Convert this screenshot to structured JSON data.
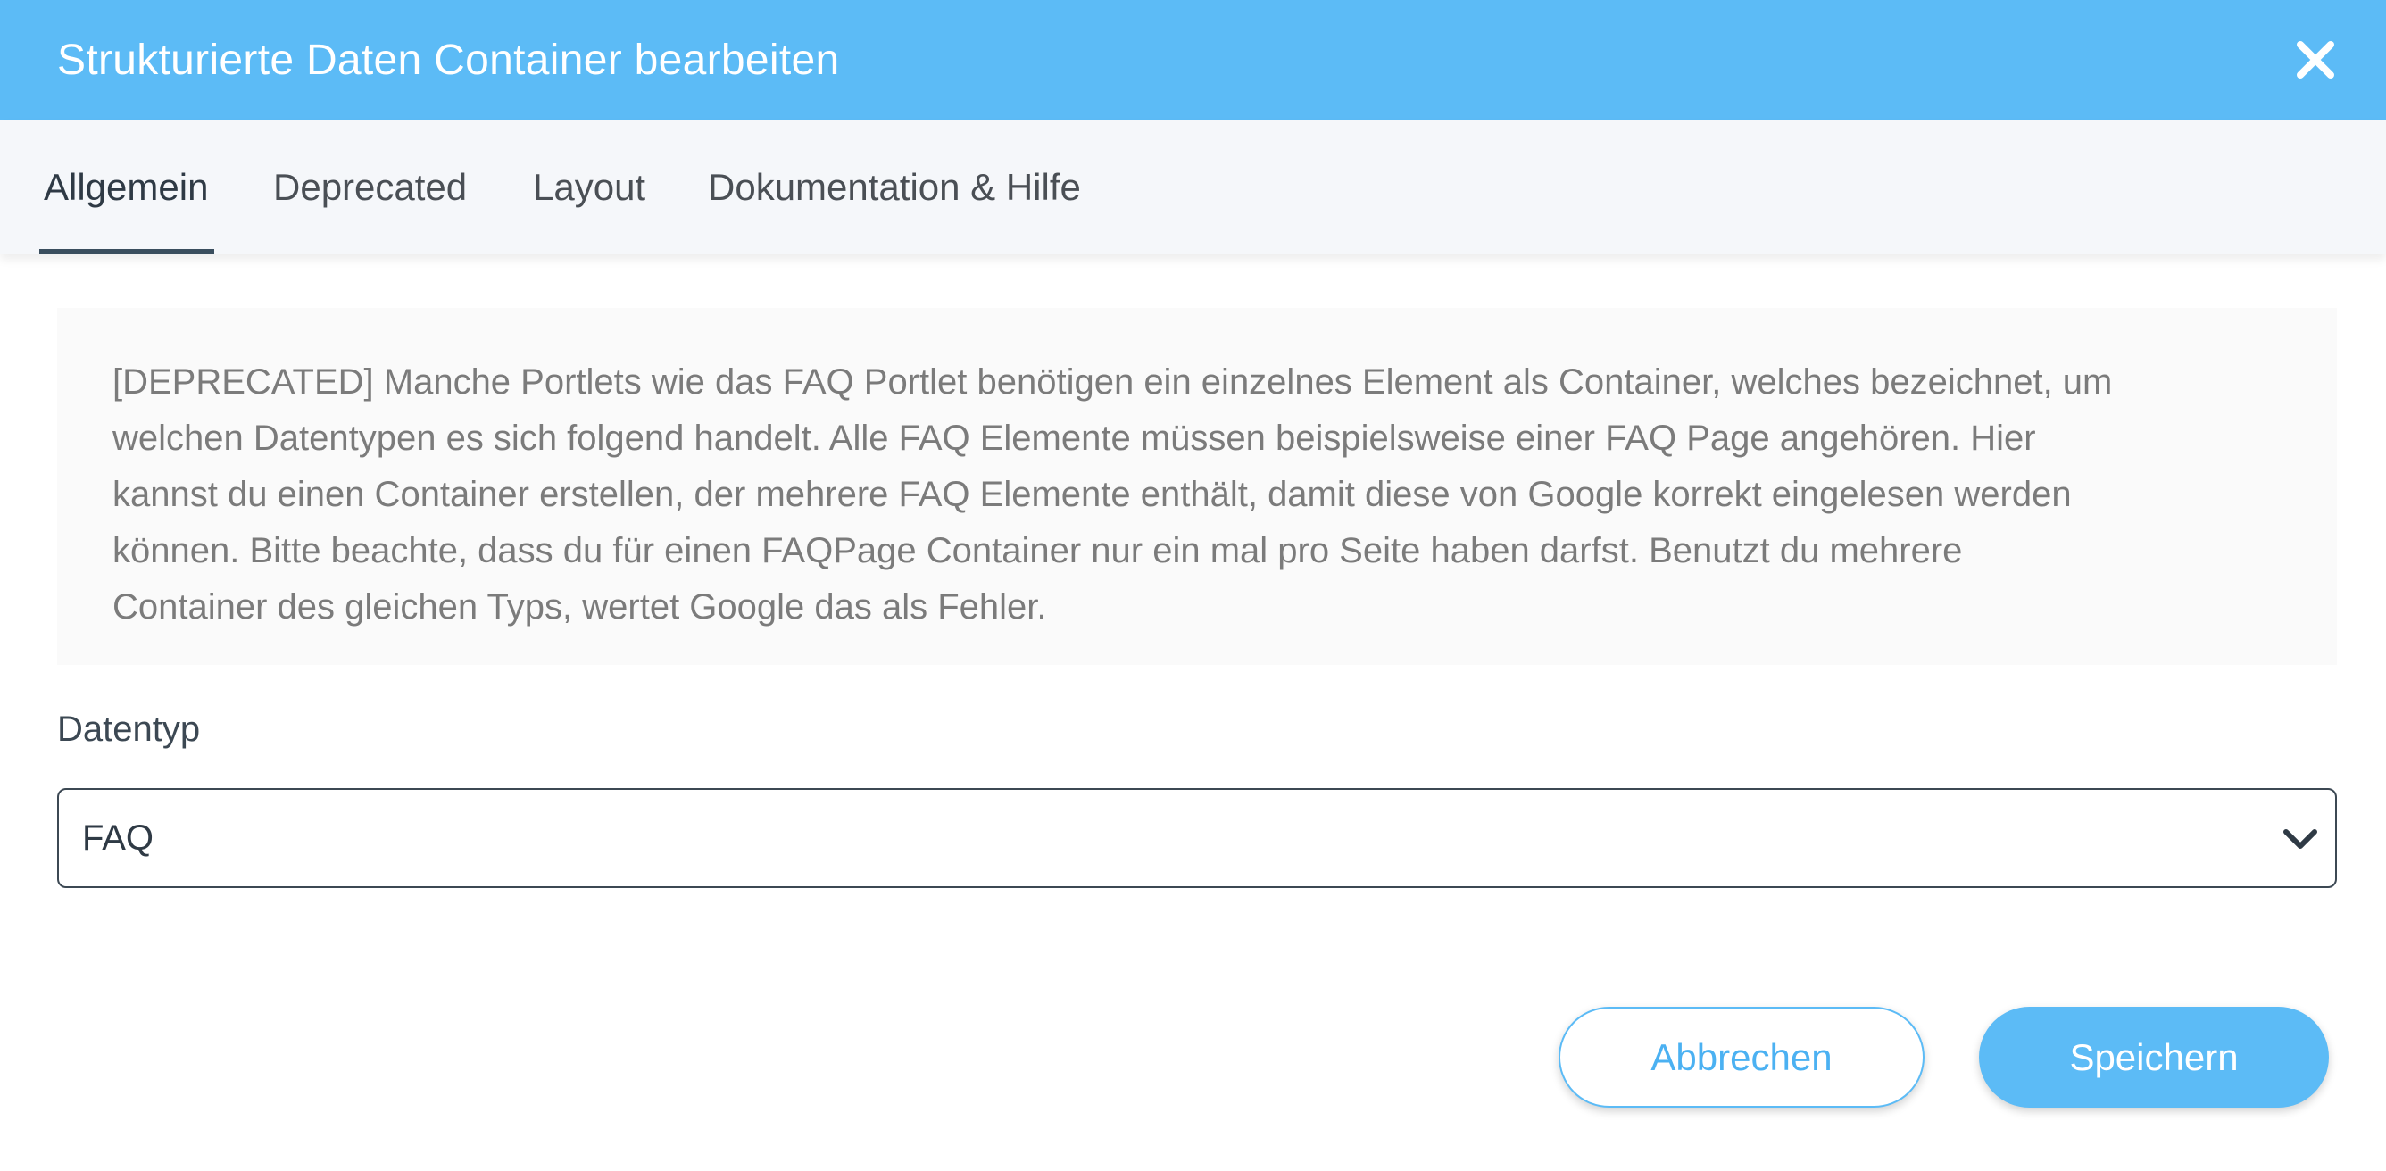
{
  "dialog": {
    "title": "Strukturierte Daten Container bearbeiten"
  },
  "tabs": [
    {
      "label": "Allgemein",
      "active": true
    },
    {
      "label": "Deprecated",
      "active": false
    },
    {
      "label": "Layout",
      "active": false
    },
    {
      "label": "Dokumentation & Hilfe",
      "active": false
    }
  ],
  "info": {
    "lines": [
      "[DEPRECATED] Manche Portlets wie das FAQ Portlet benötigen ein einzelnes Element als Container, welches bezeichnet, um",
      "welchen Datentypen es sich folgend handelt. Alle FAQ Elemente müssen beispielsweise einer FAQ Page angehören. Hier",
      "kannst du einen Container erstellen, der mehrere FAQ Elemente enthält, damit diese von Google korrekt eingelesen werden",
      "können. Bitte beachte, dass du für einen FAQPage Container nur ein mal pro Seite haben darfst. Benutzt du mehrere",
      "Container des gleichen Typs, wertet Google das als Fehler."
    ]
  },
  "form": {
    "datatype_label": "Datentyp",
    "datatype_value": "FAQ"
  },
  "buttons": {
    "cancel": "Abbrechen",
    "save": "Speichern"
  },
  "colors": {
    "accent": "#5cbbf6",
    "tab_indicator": "#3a4e5e",
    "info_text": "#7b7b7b"
  },
  "icons": {
    "close": "close-icon",
    "select_arrow": "chevron-down-icon"
  }
}
